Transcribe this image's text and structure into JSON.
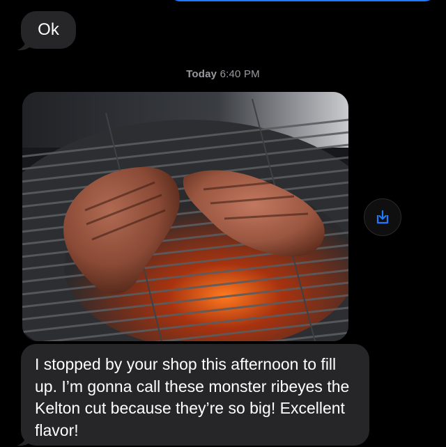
{
  "conversation": {
    "messages": [
      {
        "from": "them",
        "type": "text",
        "text": "Ok"
      },
      {
        "type": "timestamp",
        "day": "Today",
        "time": "6:40 PM"
      },
      {
        "from": "them",
        "type": "image"
      },
      {
        "from": "them",
        "type": "text",
        "text": "I stopped by your shop this afternoon to fill up. I’m gonna call these monster ribeyes the Kelton cut because they’re so big! Excellent flavor!"
      }
    ]
  },
  "colors": {
    "background": "#000000",
    "incoming_bubble": "#262628",
    "outgoing_bubble": "#1f7aff",
    "timestamp_text": "#9a9a9f",
    "accent": "#1f7aff"
  },
  "icons": {
    "save_image": "download-to-tray-icon"
  }
}
